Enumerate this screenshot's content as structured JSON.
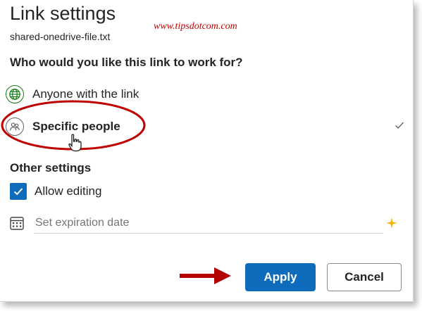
{
  "dialog": {
    "title": "Link settings",
    "filename": "shared-onedrive-file.txt",
    "watermark": "www.tipsdotcom.com",
    "question": "Who would you like this link to work for?",
    "options": [
      {
        "label": "Anyone with the link",
        "icon": "globe-icon",
        "selected": false
      },
      {
        "label": "Specific people",
        "icon": "people-icon",
        "selected": true
      }
    ],
    "other_settings_heading": "Other settings",
    "allow_editing": {
      "label": "Allow editing",
      "checked": true
    },
    "expiration": {
      "placeholder": "Set expiration date",
      "icon": "calendar-icon",
      "accent_icon": "sparkle-icon"
    },
    "buttons": {
      "apply": "Apply",
      "cancel": "Cancel"
    }
  },
  "colors": {
    "accent": "#0f6cbd",
    "globe": "#107c10",
    "annotation": "#c00000",
    "sparkle": "#f0b400"
  }
}
